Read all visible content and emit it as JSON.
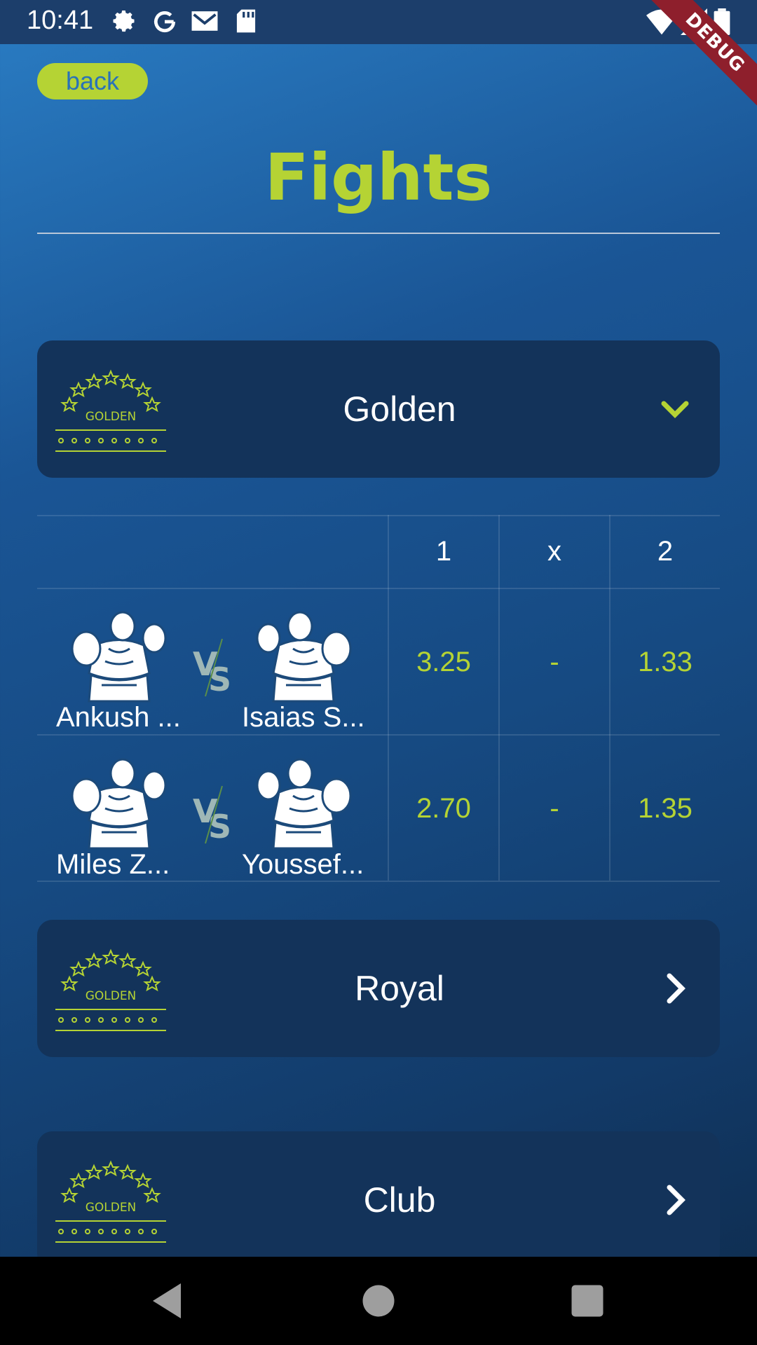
{
  "status_bar": {
    "time": "10:41",
    "icons": [
      "gear-icon",
      "google-icon",
      "mail-icon",
      "sd-card-icon",
      "wifi-icon",
      "signal-icon",
      "battery-icon"
    ],
    "debug_label": "DEBUG"
  },
  "header": {
    "back_label": "back",
    "title": "Fights"
  },
  "colors": {
    "accent": "#b5d334",
    "card": "#13335a",
    "back_text": "#2a72b8"
  },
  "leagues": [
    {
      "logo_text": "GOLDEN",
      "name": "Golden",
      "expanded": true
    },
    {
      "logo_text": "GOLDEN",
      "name": "Royal",
      "expanded": false
    },
    {
      "logo_text": "GOLDEN",
      "name": "Club",
      "expanded": false
    }
  ],
  "odds_table": {
    "headers": [
      "1",
      "x",
      "2"
    ],
    "vs_label": "VS",
    "rows": [
      {
        "fighter1": "Ankush ...",
        "fighter2": "Isaias S...",
        "odd1": "3.25",
        "oddx": "-",
        "odd2": "1.33"
      },
      {
        "fighter1": "Miles Z...",
        "fighter2": "Youssef...",
        "odd1": "2.70",
        "oddx": "-",
        "odd2": "1.35"
      }
    ]
  }
}
